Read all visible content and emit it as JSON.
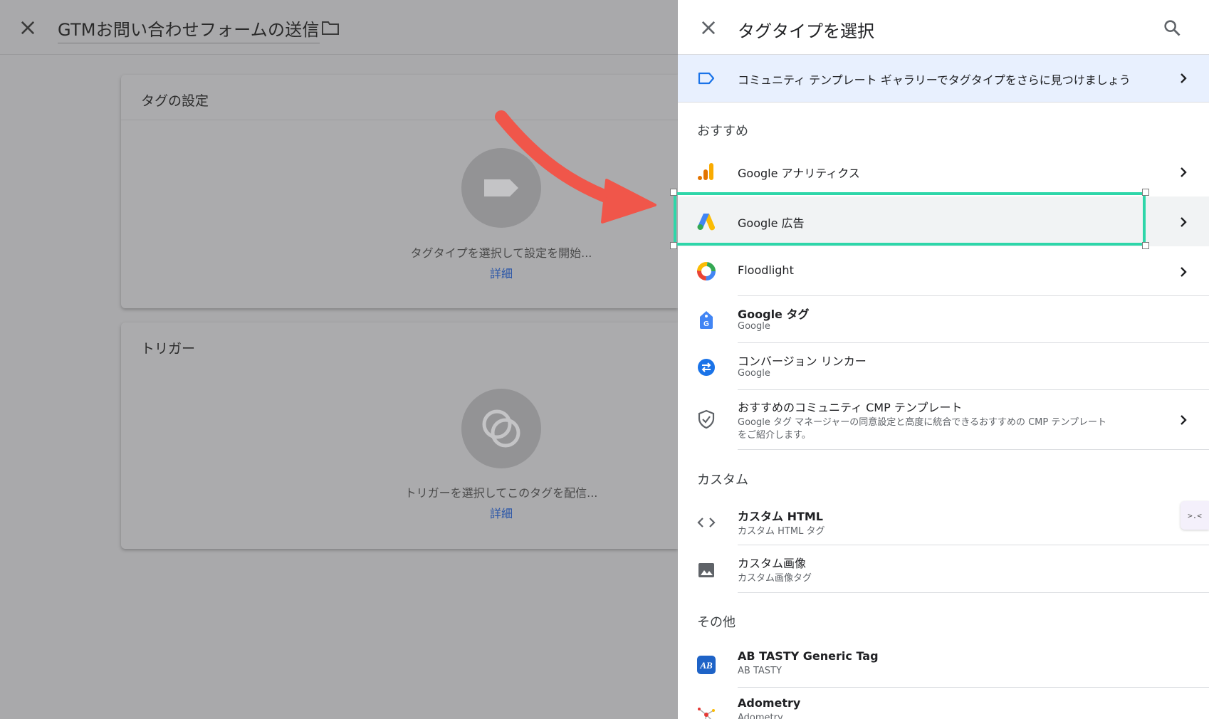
{
  "editor": {
    "title": "GTMお問い合わせフォームの送信",
    "tag_card": {
      "title": "タグの設定",
      "hint": "タグタイプを選択して設定を開始...",
      "link": "詳細"
    },
    "trigger_card": {
      "title": "トリガー",
      "hint": "トリガーを選択してこのタグを配信...",
      "link": "詳細"
    }
  },
  "panel": {
    "title": "タグタイプを選択",
    "banner": "コミュニティ テンプレート ギャラリーでタグタイプをさらに見つけましょう",
    "sections": {
      "featured": "おすすめ",
      "custom": "カスタム",
      "other": "その他"
    },
    "featured_items": [
      {
        "label": "Google アナリティクス",
        "icon": "google-analytics-icon"
      },
      {
        "label": "Google 広告",
        "icon": "google-ads-icon",
        "selected": true
      },
      {
        "label": "Floodlight",
        "icon": "floodlight-icon"
      },
      {
        "label": "Google タグ",
        "sub": "Google",
        "icon": "google-tag-icon"
      },
      {
        "label": "コンバージョン リンカー",
        "sub": "Google",
        "icon": "conversion-linker-icon"
      },
      {
        "label": "おすすめのコミュニティ CMP テンプレート",
        "sub1": "Google タグ マネージャーの同意設定と高度に統合できるおすすめの CMP テンプレート",
        "sub2": "をご紹介します。",
        "icon": "shield-check-icon"
      }
    ],
    "custom_items": [
      {
        "label": "カスタム HTML",
        "sub": "カスタム HTML タグ",
        "icon": "code-icon"
      },
      {
        "label": "カスタム画像",
        "sub": "カスタム画像タグ",
        "icon": "image-icon"
      }
    ],
    "other_items": [
      {
        "label": "AB TASTY Generic Tag",
        "sub": "AB TASTY",
        "icon": "ab-tasty-icon"
      },
      {
        "label": "Adometry",
        "sub": "Adometry",
        "icon": "adometry-icon"
      }
    ]
  },
  "colors": {
    "selection": "#2ed6a9",
    "arrow": "#f0564a",
    "banner_bg": "#e8f0fe",
    "link": "#2a56a8"
  }
}
